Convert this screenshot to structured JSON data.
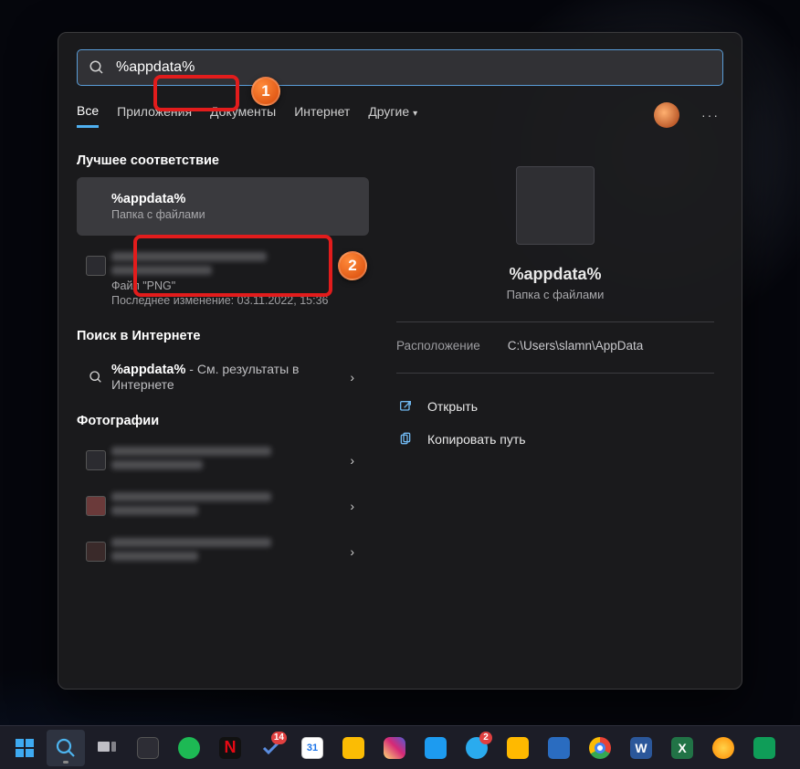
{
  "search": {
    "query": "%appdata%"
  },
  "callouts": {
    "one": "1",
    "two": "2"
  },
  "tabs": {
    "all": "Все",
    "apps": "Приложения",
    "docs": "Документы",
    "web": "Интернет",
    "more": "Другие"
  },
  "sections": {
    "best": "Лучшее соответствие",
    "web": "Поиск в Интернете",
    "photos": "Фотографии"
  },
  "bestMatch": {
    "title": "%appdata%",
    "subtitle": "Папка с файлами"
  },
  "pngResult": {
    "sub1": "Файл \"PNG\"",
    "sub2": "Последнее изменение: 03.11.2022, 15:36"
  },
  "webResult": {
    "title_prefix": "%appdata%",
    "title_suffix": " - См. результаты в Интернете"
  },
  "preview": {
    "title": "%appdata%",
    "subtitle": "Папка с файлами",
    "location_label": "Расположение",
    "location_value": "C:\\Users\\slamn\\AppData",
    "open": "Открыть",
    "copy": "Копировать путь"
  },
  "taskbar": {
    "todos_badge": "14",
    "tg_badge": "2",
    "gcal_day": "31"
  }
}
